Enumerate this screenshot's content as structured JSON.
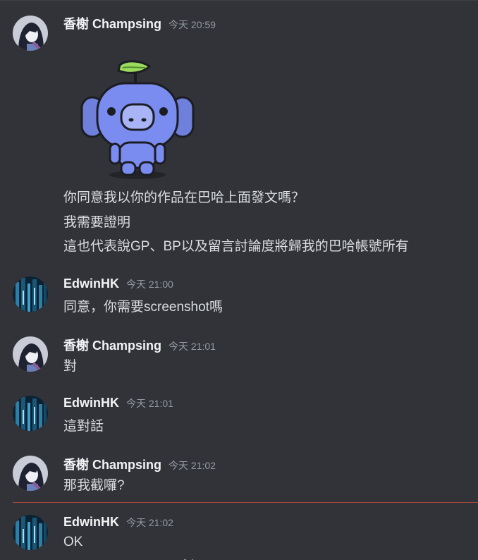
{
  "messages": [
    {
      "author": "香榭 Champsing",
      "timestamp": "今天 20:59",
      "sticker": "wumpus-sticker",
      "lines": [
        "你同意我以你的作品在巴哈上面發文嗎？",
        "我需要證明",
        "這也代表說GP、BP以及留言討論度將歸我的巴哈帳號所有"
      ]
    },
    {
      "author": "EdwinHK",
      "timestamp": "今天 21:00",
      "lines": [
        "同意，你需要screenshot嗎"
      ]
    },
    {
      "author": "香榭 Champsing",
      "timestamp": "今天 21:01",
      "lines": [
        "對"
      ]
    },
    {
      "author": "EdwinHK",
      "timestamp": "今天 21:01",
      "lines": [
        "這對話"
      ]
    },
    {
      "author": "香榭 Champsing",
      "timestamp": "今天 21:02",
      "lines": [
        "那我截囉?"
      ]
    },
    {
      "author": "EdwinHK",
      "timestamp": "今天 21:02",
      "lines": [
        "OK"
      ]
    }
  ],
  "colors": {
    "background": "#313338",
    "username": "#f2f3f5",
    "text": "#dbdee1",
    "timestamp": "#949ba4",
    "new_messages_divider": "#a5453f"
  }
}
